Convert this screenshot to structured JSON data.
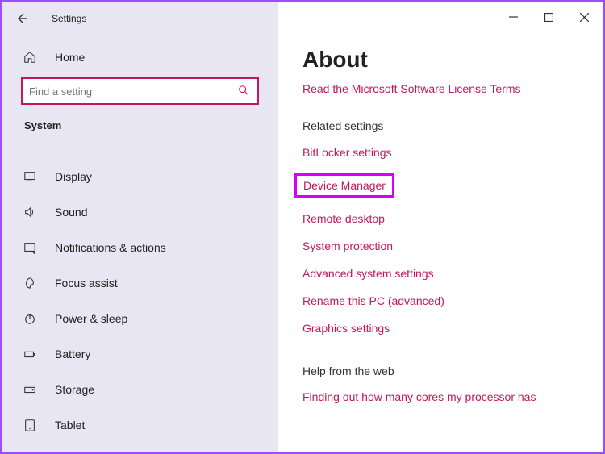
{
  "titlebar": {
    "label": "Settings"
  },
  "home": {
    "label": "Home"
  },
  "search": {
    "placeholder": "Find a setting"
  },
  "category": "System",
  "nav": [
    {
      "icon": "display-icon",
      "label": "Display"
    },
    {
      "icon": "sound-icon",
      "label": "Sound"
    },
    {
      "icon": "notifications-icon",
      "label": "Notifications & actions"
    },
    {
      "icon": "focus-assist-icon",
      "label": "Focus assist"
    },
    {
      "icon": "power-icon",
      "label": "Power & sleep"
    },
    {
      "icon": "battery-icon",
      "label": "Battery"
    },
    {
      "icon": "storage-icon",
      "label": "Storage"
    },
    {
      "icon": "tablet-icon",
      "label": "Tablet"
    }
  ],
  "page": {
    "title": "About",
    "topLink": "Read the Microsoft Software License Terms",
    "relatedLabel": "Related settings",
    "relatedLinks": [
      "BitLocker settings",
      "Device Manager",
      "Remote desktop",
      "System protection",
      "Advanced system settings",
      "Rename this PC (advanced)",
      "Graphics settings"
    ],
    "helpLabel": "Help from the web",
    "helpLinks": [
      "Finding out how many cores my processor has"
    ]
  }
}
